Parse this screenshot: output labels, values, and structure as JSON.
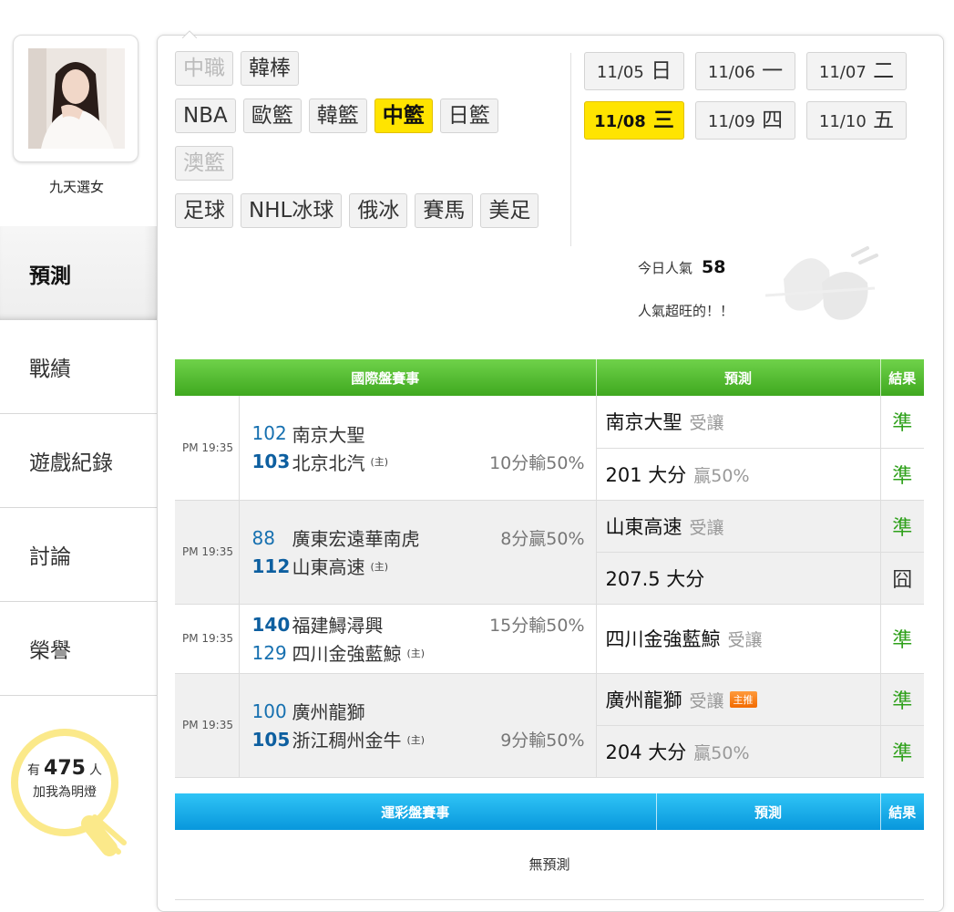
{
  "user": {
    "name": "九天選女"
  },
  "nav": [
    {
      "label": "預測",
      "active": true
    },
    {
      "label": "戰績",
      "active": false
    },
    {
      "label": "遊戲紀錄",
      "active": false
    },
    {
      "label": "討論",
      "active": false
    },
    {
      "label": "榮譽",
      "active": false
    }
  ],
  "lamp": {
    "prefix": "有",
    "count": "475",
    "suffix": "人",
    "line2": "加我為明燈"
  },
  "categories": {
    "row1": [
      {
        "label": "中職",
        "state": "disabled"
      },
      {
        "label": "韓棒",
        "state": "normal"
      }
    ],
    "row2": [
      {
        "label": "NBA",
        "state": "normal"
      },
      {
        "label": "歐籃",
        "state": "normal"
      },
      {
        "label": "韓籃",
        "state": "normal"
      },
      {
        "label": "中籃",
        "state": "active"
      },
      {
        "label": "日籃",
        "state": "normal"
      }
    ],
    "row3": [
      {
        "label": "澳籃",
        "state": "disabled"
      }
    ],
    "row4": [
      {
        "label": "足球",
        "state": "normal"
      },
      {
        "label": "NHL冰球",
        "state": "normal"
      },
      {
        "label": "俄冰",
        "state": "normal"
      },
      {
        "label": "賽馬",
        "state": "normal"
      },
      {
        "label": "美足",
        "state": "normal"
      }
    ]
  },
  "dates": [
    {
      "md": "11/05",
      "dow": "日",
      "active": false
    },
    {
      "md": "11/06",
      "dow": "一",
      "active": false
    },
    {
      "md": "11/07",
      "dow": "二",
      "active": false
    },
    {
      "md": "11/08",
      "dow": "三",
      "active": true
    },
    {
      "md": "11/09",
      "dow": "四",
      "active": false
    },
    {
      "md": "11/10",
      "dow": "五",
      "active": false
    }
  ],
  "popularity": {
    "label": "今日人氣",
    "value": "58",
    "note": "人氣超旺的！！"
  },
  "intl_table": {
    "headers": [
      "國際盤賽事",
      "預測",
      "結果"
    ],
    "games": [
      {
        "time": "PM 19:35",
        "away": {
          "no": "102",
          "name": "南京大聖",
          "line": ""
        },
        "home": {
          "no": "103",
          "name": "北京北汽",
          "home_mark": "(主)",
          "line": "10分輸50%"
        },
        "preds": [
          {
            "main": "南京大聖",
            "sub": "受讓",
            "badge": "",
            "result": "準"
          },
          {
            "main": "201 大分",
            "sub": "贏50%",
            "badge": "",
            "result": "準"
          }
        ]
      },
      {
        "time": "PM 19:35",
        "away": {
          "no": "88",
          "name": "廣東宏遠華南虎",
          "line": "8分贏50%"
        },
        "home": {
          "no": "112",
          "name": "山東高速",
          "home_mark": "(主)",
          "line": ""
        },
        "preds": [
          {
            "main": "山東高速",
            "sub": "受讓",
            "badge": "",
            "result": "準"
          },
          {
            "main": "207.5 大分",
            "sub": "",
            "badge": "",
            "result": "囧"
          }
        ]
      },
      {
        "time": "PM 19:35",
        "away": {
          "no": "140",
          "name": "福建鱘潯興",
          "line": "15分輸50%"
        },
        "home": {
          "no": "129",
          "name": "四川金強藍鯨",
          "home_mark": "(主)",
          "line": ""
        },
        "preds": [
          {
            "main": "四川金強藍鯨",
            "sub": "受讓",
            "badge": "",
            "result": "準"
          }
        ]
      },
      {
        "time": "PM 19:35",
        "away": {
          "no": "100",
          "name": "廣州龍獅",
          "line": ""
        },
        "home": {
          "no": "105",
          "name": "浙江稠州金牛",
          "home_mark": "(主)",
          "line": "9分輸50%"
        },
        "preds": [
          {
            "main": "廣州龍獅",
            "sub": "受讓",
            "badge": "主推",
            "result": "準"
          },
          {
            "main": "204 大分",
            "sub": "贏50%",
            "badge": "",
            "result": "準"
          }
        ]
      }
    ]
  },
  "sports_table": {
    "headers": [
      "運彩盤賽事",
      "預測",
      "結果"
    ],
    "empty_text": "無預測"
  },
  "colors": {
    "accent_yellow": "#ffe400",
    "header_green": "#4fb82a",
    "header_blue": "#14a9e8",
    "win_green": "#2ea01a"
  }
}
